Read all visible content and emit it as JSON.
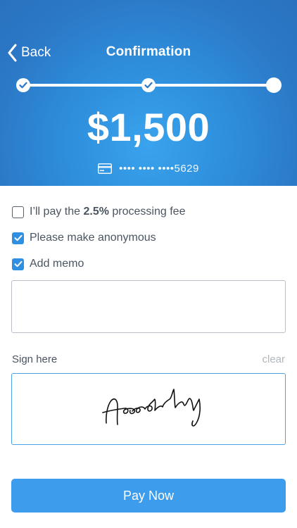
{
  "header": {
    "back_label": "Back",
    "title": "Confirmation",
    "amount": "$1,500",
    "card_masked": "•••• •••• ••••5629",
    "card_icon": "credit-card-icon"
  },
  "stepper": {
    "steps_total": 3,
    "steps_completed": 2,
    "current_step": 3
  },
  "options": {
    "fee": {
      "prefix": "I’ll pay the ",
      "bold": "2.5%",
      "suffix": " processing fee",
      "checked": false
    },
    "anonymous": {
      "label": "Please make anonymous",
      "checked": true
    },
    "memo": {
      "label": "Add memo",
      "checked": true
    }
  },
  "memo": {
    "value": ""
  },
  "signature": {
    "label": "Sign here",
    "clear_label": "clear"
  },
  "pay_button": {
    "label": "Pay Now"
  },
  "colors": {
    "header_blue": "#2b78c6",
    "accent_blue": "#3d9ceb",
    "checkbox_blue": "#2f8fe0",
    "text_gray": "#4a5561",
    "muted_gray": "#b0b6bc"
  }
}
